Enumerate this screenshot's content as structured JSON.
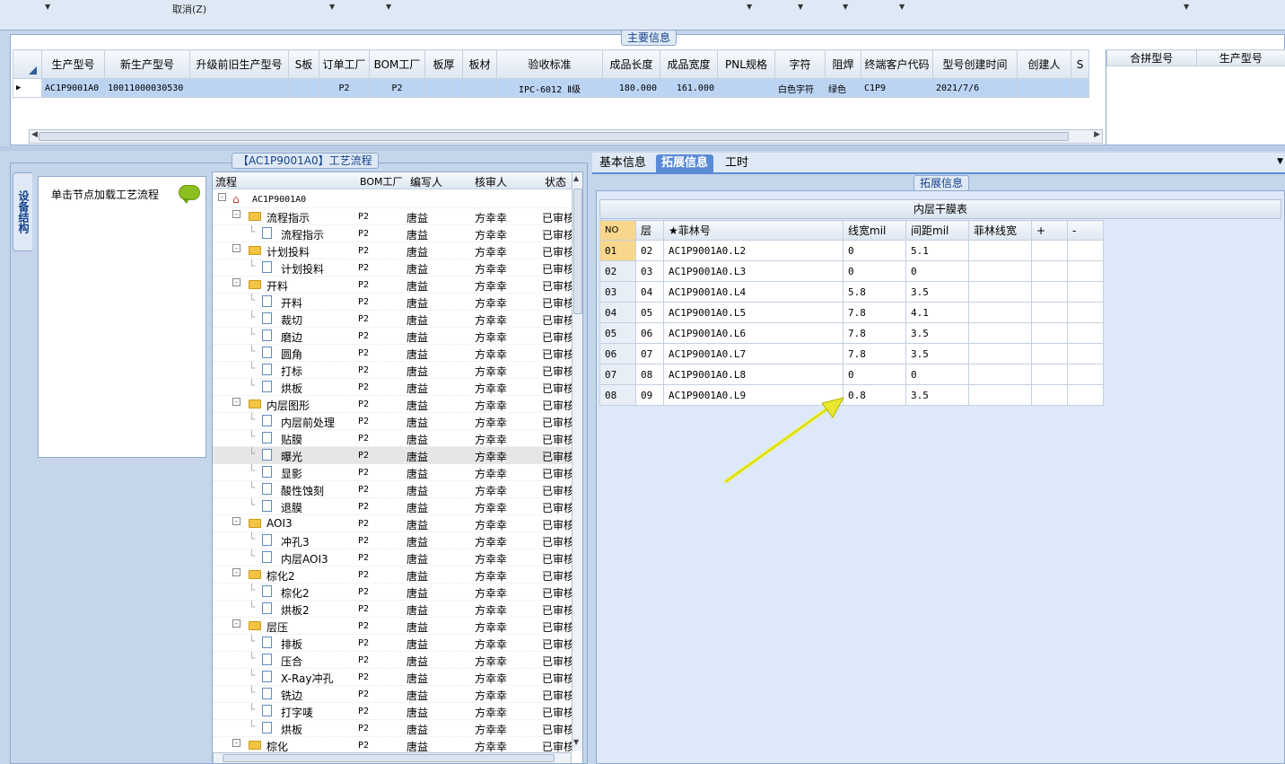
{
  "toolbar": {
    "cancel_label": "取消(Z)"
  },
  "main_info": {
    "title": "主要信息",
    "columns": [
      "生产型号",
      "新生产型号",
      "升级前旧生产型号",
      "S板",
      "订单工厂",
      "BOM工厂",
      "板厚",
      "板材",
      "验收标准",
      "成品长度",
      "成品宽度",
      "PNL规格",
      "字符",
      "阻焊",
      "终端客户代码",
      "型号创建时间",
      "创建人",
      "S"
    ],
    "row": [
      "AC1P9001A0",
      "10011000030530",
      "",
      "",
      "P2",
      "P2",
      "",
      "",
      "IPC-6012 Ⅱ级",
      "180.000",
      "161.000",
      "",
      "白色字符",
      "绿色",
      "C1P9",
      "2021/7/6",
      "",
      ""
    ],
    "right_columns": [
      "合拼型号",
      "生产型号"
    ]
  },
  "process": {
    "title": "【AC1P9001A0】工艺流程",
    "side_tab": "设备结构",
    "hint": "单击节点加载工艺流程",
    "columns": [
      "流程",
      "BOM工厂",
      "编写人",
      "核审人",
      "状态"
    ],
    "root": "AC1P9001A0",
    "rows": [
      {
        "name": "流程指示",
        "level": 1,
        "factory": "P2",
        "writer": "唐益",
        "checker": "方幸幸",
        "status": "已审核"
      },
      {
        "name": "流程指示",
        "level": 2,
        "factory": "P2",
        "writer": "唐益",
        "checker": "方幸幸",
        "status": "已审核"
      },
      {
        "name": "计划投料",
        "level": 1,
        "factory": "P2",
        "writer": "唐益",
        "checker": "方幸幸",
        "status": "已审核"
      },
      {
        "name": "计划投料",
        "level": 2,
        "factory": "P2",
        "writer": "唐益",
        "checker": "方幸幸",
        "status": "已审核"
      },
      {
        "name": "开料",
        "level": 1,
        "factory": "P2",
        "writer": "唐益",
        "checker": "方幸幸",
        "status": "已审核"
      },
      {
        "name": "开料",
        "level": 2,
        "factory": "P2",
        "writer": "唐益",
        "checker": "方幸幸",
        "status": "已审核"
      },
      {
        "name": "裁切",
        "level": 2,
        "factory": "P2",
        "writer": "唐益",
        "checker": "方幸幸",
        "status": "已审核"
      },
      {
        "name": "磨边",
        "level": 2,
        "factory": "P2",
        "writer": "唐益",
        "checker": "方幸幸",
        "status": "已审核"
      },
      {
        "name": "圆角",
        "level": 2,
        "factory": "P2",
        "writer": "唐益",
        "checker": "方幸幸",
        "status": "已审核"
      },
      {
        "name": "打标",
        "level": 2,
        "factory": "P2",
        "writer": "唐益",
        "checker": "方幸幸",
        "status": "已审核"
      },
      {
        "name": "烘板",
        "level": 2,
        "factory": "P2",
        "writer": "唐益",
        "checker": "方幸幸",
        "status": "已审核"
      },
      {
        "name": "内层图形",
        "level": 1,
        "factory": "P2",
        "writer": "唐益",
        "checker": "方幸幸",
        "status": "已审核"
      },
      {
        "name": "内层前处理",
        "level": 2,
        "factory": "P2",
        "writer": "唐益",
        "checker": "方幸幸",
        "status": "已审核"
      },
      {
        "name": "贴膜",
        "level": 2,
        "factory": "P2",
        "writer": "唐益",
        "checker": "方幸幸",
        "status": "已审核"
      },
      {
        "name": "曝光",
        "level": 2,
        "factory": "P2",
        "writer": "唐益",
        "checker": "方幸幸",
        "status": "已审核"
      },
      {
        "name": "显影",
        "level": 2,
        "factory": "P2",
        "writer": "唐益",
        "checker": "方幸幸",
        "status": "已审核"
      },
      {
        "name": "酸性蚀刻",
        "level": 2,
        "factory": "P2",
        "writer": "唐益",
        "checker": "方幸幸",
        "status": "已审核"
      },
      {
        "name": "退膜",
        "level": 2,
        "factory": "P2",
        "writer": "唐益",
        "checker": "方幸幸",
        "status": "已审核"
      },
      {
        "name": "AOI3",
        "level": 1,
        "factory": "P2",
        "writer": "唐益",
        "checker": "方幸幸",
        "status": "已审核"
      },
      {
        "name": "冲孔3",
        "level": 2,
        "factory": "P2",
        "writer": "唐益",
        "checker": "方幸幸",
        "status": "已审核"
      },
      {
        "name": "内层AOI3",
        "level": 2,
        "factory": "P2",
        "writer": "唐益",
        "checker": "方幸幸",
        "status": "已审核"
      },
      {
        "name": "棕化2",
        "level": 1,
        "factory": "P2",
        "writer": "唐益",
        "checker": "方幸幸",
        "status": "已审核"
      },
      {
        "name": "棕化2",
        "level": 2,
        "factory": "P2",
        "writer": "唐益",
        "checker": "方幸幸",
        "status": "已审核"
      },
      {
        "name": "烘板2",
        "level": 2,
        "factory": "P2",
        "writer": "唐益",
        "checker": "方幸幸",
        "status": "已审核"
      },
      {
        "name": "层压",
        "level": 1,
        "factory": "P2",
        "writer": "唐益",
        "checker": "方幸幸",
        "status": "已审核"
      },
      {
        "name": "排板",
        "level": 2,
        "factory": "P2",
        "writer": "唐益",
        "checker": "方幸幸",
        "status": "已审核"
      },
      {
        "name": "压合",
        "level": 2,
        "factory": "P2",
        "writer": "唐益",
        "checker": "方幸幸",
        "status": "已审核"
      },
      {
        "name": "X-Ray冲孔",
        "level": 2,
        "factory": "P2",
        "writer": "唐益",
        "checker": "方幸幸",
        "status": "已审核"
      },
      {
        "name": "铣边",
        "level": 2,
        "factory": "P2",
        "writer": "唐益",
        "checker": "方幸幸",
        "status": "已审核"
      },
      {
        "name": "打字唛",
        "level": 2,
        "factory": "P2",
        "writer": "唐益",
        "checker": "方幸幸",
        "status": "已审核"
      },
      {
        "name": "烘板",
        "level": 2,
        "factory": "P2",
        "writer": "唐益",
        "checker": "方幸幸",
        "status": "已审核"
      },
      {
        "name": "棕化",
        "level": 1,
        "factory": "P2",
        "writer": "唐益",
        "checker": "方幸幸",
        "status": "已审核"
      }
    ]
  },
  "tabs": [
    "基本信息",
    "拓展信息",
    "工时"
  ],
  "ext": {
    "title": "拓展信息",
    "table_title": "内层干膜表",
    "columns": [
      "NO",
      "层",
      "★菲林号",
      "线宽mil",
      "间距mil",
      "菲林线宽",
      "+",
      "-"
    ],
    "rows": [
      [
        "01",
        "02",
        "AC1P9001A0.L2",
        "0",
        "5.1",
        "",
        "",
        ""
      ],
      [
        "02",
        "03",
        "AC1P9001A0.L3",
        "0",
        "0",
        "",
        "",
        ""
      ],
      [
        "03",
        "04",
        "AC1P9001A0.L4",
        "5.8",
        "3.5",
        "",
        "",
        ""
      ],
      [
        "04",
        "05",
        "AC1P9001A0.L5",
        "7.8",
        "4.1",
        "",
        "",
        ""
      ],
      [
        "05",
        "06",
        "AC1P9001A0.L6",
        "7.8",
        "3.5",
        "",
        "",
        ""
      ],
      [
        "06",
        "07",
        "AC1P9001A0.L7",
        "7.8",
        "3.5",
        "",
        "",
        ""
      ],
      [
        "07",
        "08",
        "AC1P9001A0.L8",
        "0",
        "0",
        "",
        "",
        ""
      ],
      [
        "08",
        "09",
        "AC1P9001A0.L9",
        "0.8",
        "3.5",
        "",
        "",
        ""
      ]
    ]
  }
}
